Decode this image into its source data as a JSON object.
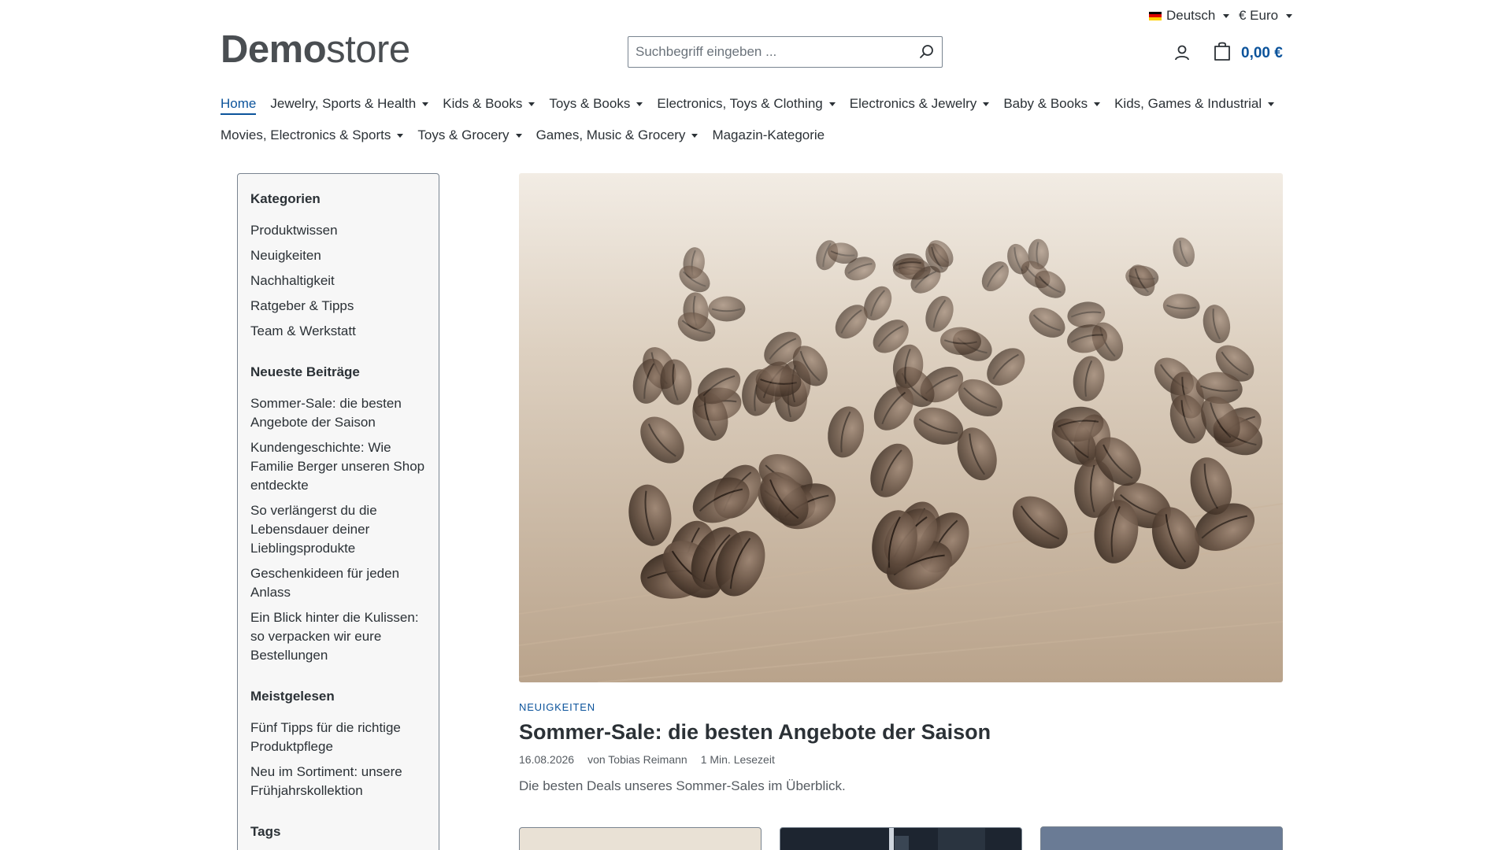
{
  "topbar": {
    "language": "Deutsch",
    "currency": "€ Euro",
    "flag_colors": [
      "#000000",
      "#dd0000",
      "#ffce00"
    ]
  },
  "header": {
    "logo_bold": "Demo",
    "logo_light": "store",
    "search_placeholder": "Suchbegriff eingeben ...",
    "cart_total": "0,00 €"
  },
  "nav": {
    "row1": [
      {
        "label": "Home",
        "active": true,
        "dropdown": false
      },
      {
        "label": "Jewelry, Sports & Health",
        "dropdown": true
      },
      {
        "label": "Kids & Books",
        "dropdown": true
      },
      {
        "label": "Toys & Books",
        "dropdown": true
      },
      {
        "label": "Electronics, Toys & Clothing",
        "dropdown": true
      },
      {
        "label": "Electronics & Jewelry",
        "dropdown": true
      },
      {
        "label": "Baby & Books",
        "dropdown": true
      },
      {
        "label": "Kids, Games & Industrial",
        "dropdown": true
      }
    ],
    "row2": [
      {
        "label": "Movies, Electronics & Sports",
        "dropdown": true
      },
      {
        "label": "Toys & Grocery",
        "dropdown": true
      },
      {
        "label": "Games, Music & Grocery",
        "dropdown": true
      },
      {
        "label": "Magazin-Kategorie",
        "dropdown": false
      }
    ]
  },
  "sidebar": {
    "categories_title": "Kategorien",
    "categories": [
      "Produktwissen",
      "Neuigkeiten",
      "Nachhaltigkeit",
      "Ratgeber & Tipps",
      "Team & Werkstatt"
    ],
    "latest_title": "Neueste Beiträge",
    "latest": [
      "Sommer-Sale: die besten Angebote der Saison",
      "Kundengeschichte: Wie Familie Berger unseren Shop entdeckte",
      "So verlängerst du die Lebensdauer deiner Lieblingsprodukte",
      "Geschenkideen für jeden Anlass",
      "Ein Blick hinter die Kulissen: so verpacken wir eure Bestellungen"
    ],
    "popular_title": "Meistgelesen",
    "popular": [
      "Fünf Tipps für die richtige Produktpflege",
      "Neu im Sortiment: unsere Frühjahrskollektion"
    ],
    "tags_title": "Tags"
  },
  "article": {
    "category": "NEUIGKEITEN",
    "title": "Sommer-Sale: die besten Angebote der Saison",
    "date": "16.08.2026",
    "author": "von Tobias Reimann",
    "read_time": "1 Min. Lesezeit",
    "excerpt": "Die besten Deals unseres Sommer-Sales im Überblick."
  },
  "colors": {
    "accent": "#0b539b",
    "text": "#2b3136",
    "border": "#798490",
    "sidebar_bg": "#f7f7f7"
  }
}
